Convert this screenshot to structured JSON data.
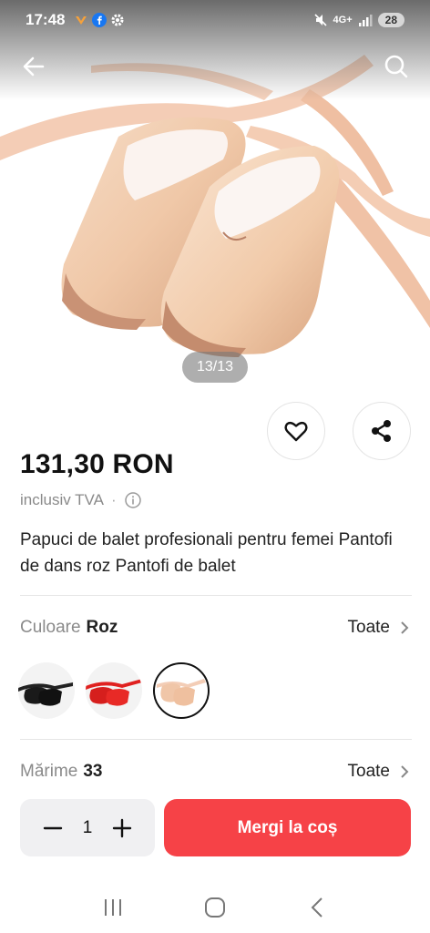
{
  "status_bar": {
    "time": "17:48",
    "network": "4G+",
    "battery": "28"
  },
  "gallery": {
    "counter": "13/13"
  },
  "product": {
    "price": "131,30 RON",
    "vat_label": "inclusiv TVA",
    "vat_separator": "·",
    "title": "Papuci de balet profesionali pentru femei Pantofi de dans roz Pantofi de balet"
  },
  "color_option": {
    "label": "Culoare",
    "value": "Roz",
    "all_label": "Toate",
    "swatches": [
      {
        "name": "black",
        "color": "#1a1a1a"
      },
      {
        "name": "red",
        "color": "#e0211f"
      },
      {
        "name": "pink",
        "color": "#f2c9b4"
      }
    ],
    "selected_index": 2
  },
  "size_option": {
    "label": "Mărime",
    "value": "33",
    "all_label": "Toate"
  },
  "purchase": {
    "quantity": "1",
    "cart_label": "Mergi la coș",
    "accent_color": "#f64247"
  }
}
